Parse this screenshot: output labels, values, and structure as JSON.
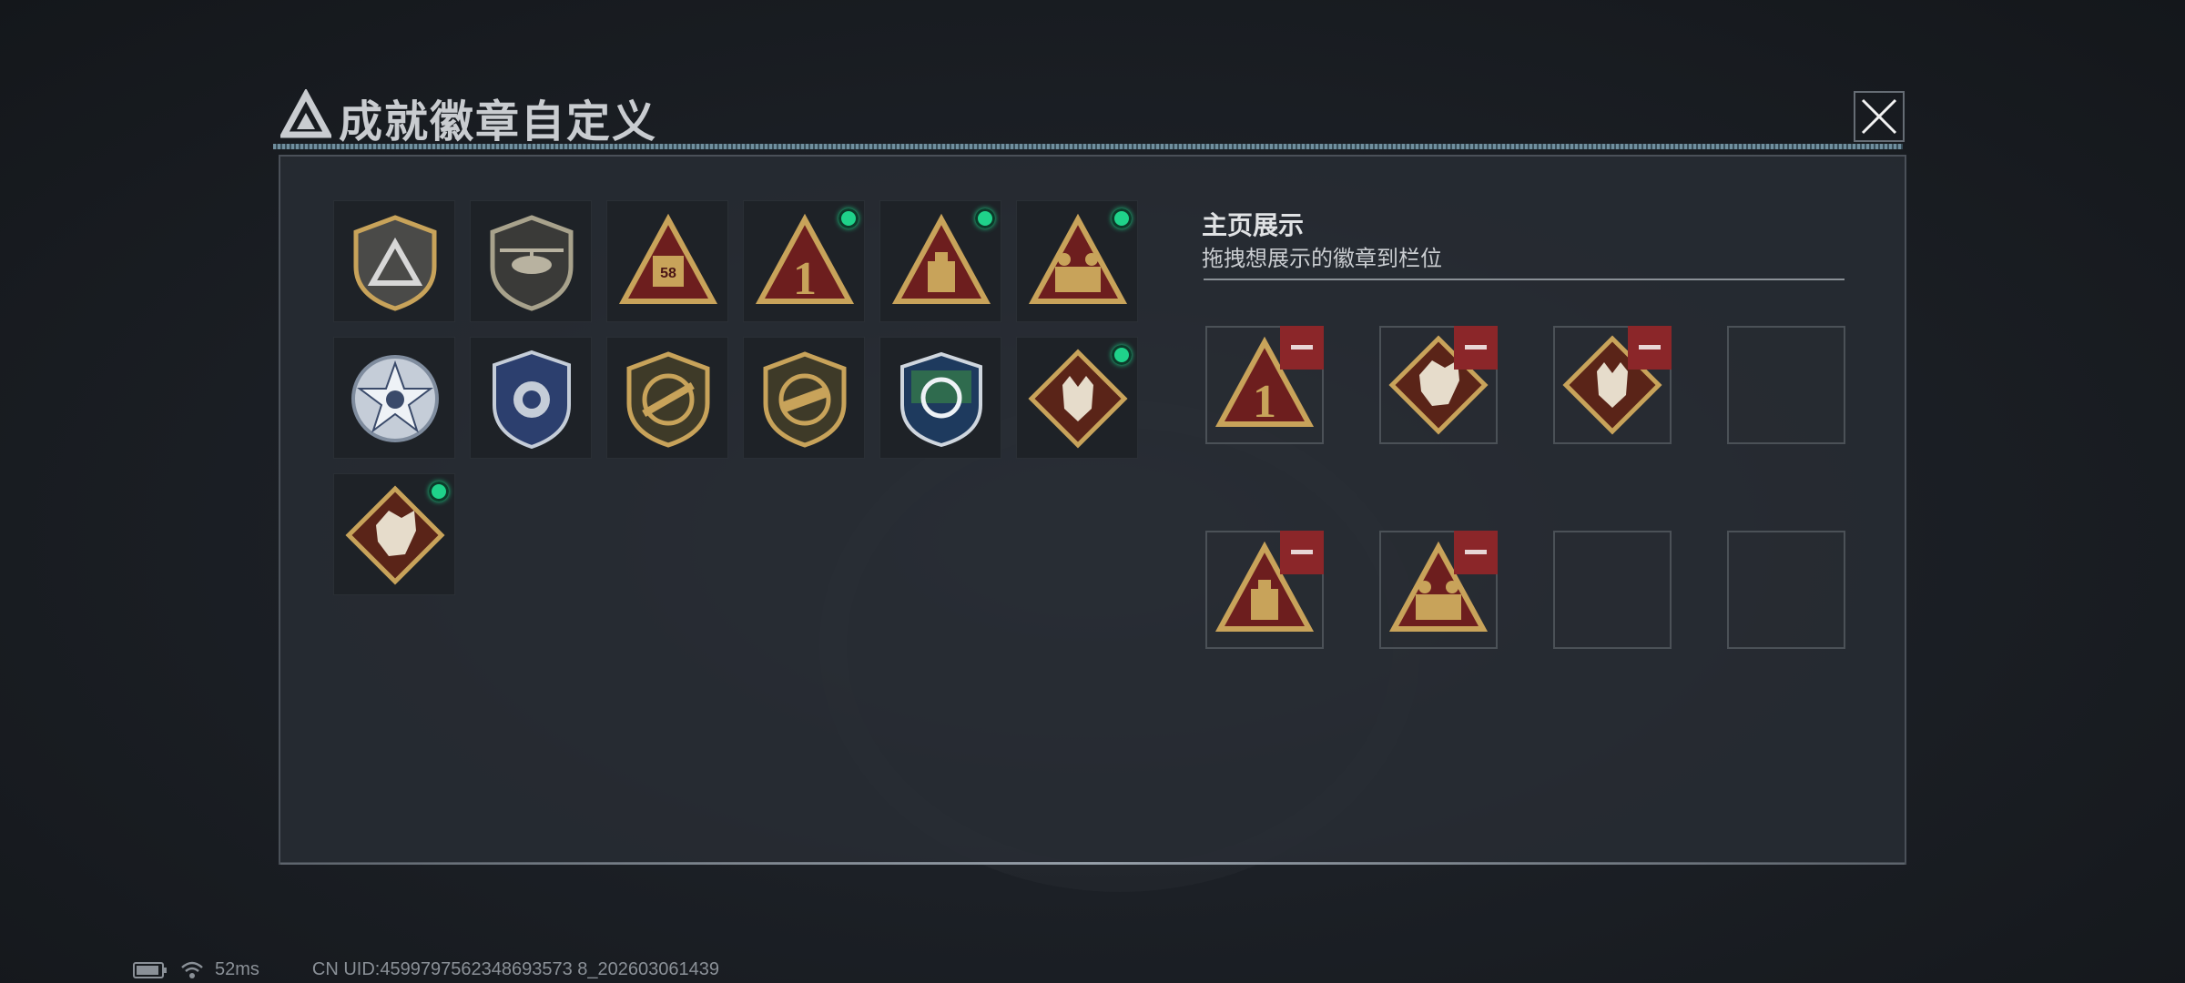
{
  "title": "成就徽章自定义",
  "colors": {
    "accent_green": "#1fd28a",
    "remove_red": "#8b2629",
    "panel_bg": "#282d34",
    "gold": "#c8a35a"
  },
  "badges": [
    {
      "icon": "gray-shield-triangle-badge",
      "new": false
    },
    {
      "icon": "helicopter-shield-badge",
      "new": false
    },
    {
      "icon": "triangle-58-badge",
      "new": false
    },
    {
      "icon": "triangle-number-1-badge",
      "new": true
    },
    {
      "icon": "triangle-supply-badge",
      "new": true
    },
    {
      "icon": "triangle-soldiers-badge",
      "new": true
    },
    {
      "icon": "silver-star-badge",
      "new": false
    },
    {
      "icon": "blue-police-shield-badge",
      "new": false
    },
    {
      "icon": "rifle-shield-badge",
      "new": false
    },
    {
      "icon": "smg-shield-badge",
      "new": false
    },
    {
      "icon": "green-blue-crest-badge",
      "new": false
    },
    {
      "icon": "wolf-diamond-badge",
      "new": true
    },
    {
      "icon": "dragon-diamond-badge",
      "new": true
    }
  ],
  "showcase": {
    "title": "主页展示",
    "subtitle": "拖拽想展示的徽章到栏位",
    "slots": [
      {
        "icon": "triangle-number-1-badge",
        "filled": true
      },
      {
        "icon": "dragon-diamond-badge",
        "filled": true
      },
      {
        "icon": "wolf-diamond-badge",
        "filled": true
      },
      {
        "icon": "",
        "filled": false
      },
      {
        "icon": "triangle-supply-badge",
        "filled": true
      },
      {
        "icon": "triangle-soldiers-badge",
        "filled": true
      },
      {
        "icon": "",
        "filled": false
      },
      {
        "icon": "",
        "filled": false
      }
    ]
  },
  "footer": {
    "ping": "52ms",
    "uid": "CN UID:4599797562348693573 8_202603061439"
  }
}
